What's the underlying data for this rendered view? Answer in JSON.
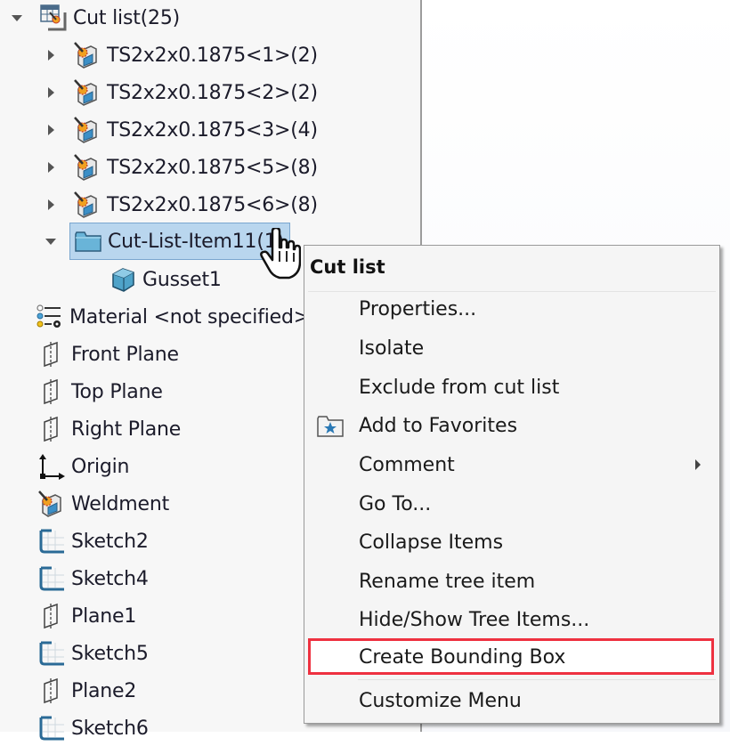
{
  "feature_tree": {
    "cut_list": {
      "label": "Cut list(25)",
      "icon": "cut-list-icon",
      "expanded": true
    },
    "cut_list_items": [
      {
        "label": "TS2x2x0.1875<1>(2)",
        "icon": "weldment-member-icon",
        "expanded": false
      },
      {
        "label": "TS2x2x0.1875<2>(2)",
        "icon": "weldment-member-icon",
        "expanded": false
      },
      {
        "label": "TS2x2x0.1875<3>(4)",
        "icon": "weldment-member-icon",
        "expanded": false
      },
      {
        "label": "TS2x2x0.1875<5>(8)",
        "icon": "weldment-member-icon",
        "expanded": false
      },
      {
        "label": "TS2x2x0.1875<6>(8)",
        "icon": "weldment-member-icon",
        "expanded": false
      }
    ],
    "selected_item": {
      "label": "Cut-List-Item11(1)",
      "icon": "folder-icon",
      "expanded": true,
      "selected": true
    },
    "selected_children": [
      {
        "label": "Gusset1",
        "icon": "solid-body-icon"
      }
    ],
    "features": [
      {
        "label": "Material <not specified>",
        "icon": "material-icon"
      },
      {
        "label": "Front Plane",
        "icon": "plane-icon"
      },
      {
        "label": "Top Plane",
        "icon": "plane-icon"
      },
      {
        "label": "Right Plane",
        "icon": "plane-icon"
      },
      {
        "label": "Origin",
        "icon": "origin-icon"
      },
      {
        "label": "Weldment",
        "icon": "weldment-icon"
      },
      {
        "label": "Sketch2",
        "icon": "sketch-icon"
      },
      {
        "label": "Sketch4",
        "icon": "sketch-icon"
      },
      {
        "label": "Plane1",
        "icon": "plane-icon"
      },
      {
        "label": "Sketch5",
        "icon": "sketch-icon"
      },
      {
        "label": "Plane2",
        "icon": "plane-icon"
      },
      {
        "label": "Sketch6",
        "icon": "sketch-icon"
      }
    ]
  },
  "context_menu": {
    "title": "Cut list",
    "items": [
      {
        "label": "Properties..."
      },
      {
        "label": "Isolate"
      },
      {
        "label": "Exclude from cut list"
      },
      {
        "label": "Add to Favorites",
        "icon": "favorites-folder-icon"
      },
      {
        "label": "Comment",
        "has_submenu": true
      },
      {
        "label": "Go To..."
      },
      {
        "label": "Collapse Items"
      },
      {
        "label": "Rename tree item"
      },
      {
        "label": "Hide/Show Tree Items..."
      },
      {
        "label": "Create Bounding Box",
        "highlighted": true
      },
      {
        "label": "Customize Menu"
      }
    ]
  },
  "colors": {
    "selection_fill": "#b9d6ee",
    "selection_border": "#7aa6cf",
    "highlight_outline": "#ee3140"
  }
}
